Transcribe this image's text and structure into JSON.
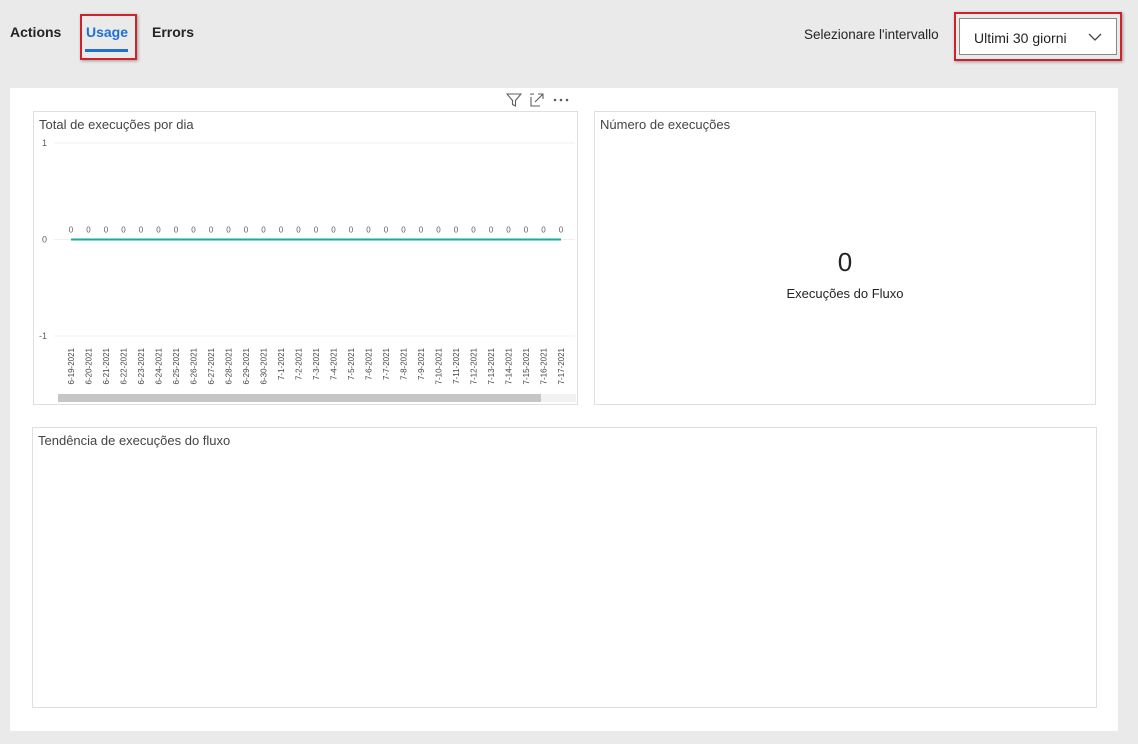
{
  "tabs": [
    {
      "label": "Actions",
      "active": false
    },
    {
      "label": "Usage",
      "active": true
    },
    {
      "label": "Errors",
      "active": false
    }
  ],
  "range": {
    "label": "Selezionare l'intervallo",
    "selected": "Ultimi 30 giorni"
  },
  "toolbar": {
    "icons": [
      "filter-icon",
      "focus-mode-icon",
      "more-options-icon"
    ]
  },
  "cards": {
    "daily_runs": {
      "title": "Total de execuções por dia"
    },
    "run_count": {
      "title": "Número de execuções",
      "value": "0",
      "label": "Execuções do Fluxo"
    },
    "trend": {
      "title": "Tendência de execuções do fluxo"
    }
  },
  "colors": {
    "accent": "#1f6fd6",
    "highlight": "#d0202a",
    "series": "#1aab9b"
  },
  "chart_data": {
    "type": "line",
    "title": "Total de execuções por dia",
    "categories": [
      "6-19-2021",
      "6-20-2021",
      "6-21-2021",
      "6-22-2021",
      "6-23-2021",
      "6-24-2021",
      "6-25-2021",
      "6-26-2021",
      "6-27-2021",
      "6-28-2021",
      "6-29-2021",
      "6-30-2021",
      "7-1-2021",
      "7-2-2021",
      "7-3-2021",
      "7-4-2021",
      "7-5-2021",
      "7-6-2021",
      "7-7-2021",
      "7-8-2021",
      "7-9-2021",
      "7-10-2021",
      "7-11-2021",
      "7-12-2021",
      "7-13-2021",
      "7-14-2021",
      "7-15-2021",
      "7-16-2021",
      "7-17-2021"
    ],
    "values": [
      0,
      0,
      0,
      0,
      0,
      0,
      0,
      0,
      0,
      0,
      0,
      0,
      0,
      0,
      0,
      0,
      0,
      0,
      0,
      0,
      0,
      0,
      0,
      0,
      0,
      0,
      0,
      0,
      0
    ],
    "ylim": [
      -1,
      1
    ],
    "yticks": [
      "1",
      "0",
      "-1"
    ],
    "grid": true,
    "data_labels": true
  }
}
